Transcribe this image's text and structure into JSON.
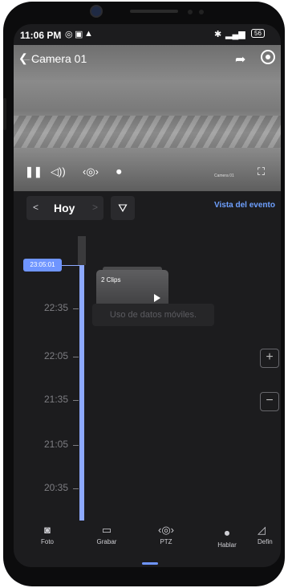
{
  "status": {
    "time": "11:06 PM",
    "battery": "56"
  },
  "camera": {
    "title": "Camera 01",
    "osd_timestamp": "—— —— —— ——",
    "osd_label": "Camera 01"
  },
  "controls": [
    "pause",
    "volume",
    "ptz",
    "mic",
    "fullscreen"
  ],
  "date_selector": {
    "label": "Hoy",
    "prev": "<",
    "next": ">"
  },
  "event_view_link": "Vista del evento",
  "timeline": {
    "current_time": "23:05:01",
    "labels": [
      "22:35",
      "22:05",
      "21:35",
      "21:05",
      "20:35"
    ]
  },
  "clip_card": {
    "title": "2 Clips"
  },
  "toast": "Uso de datos móviles.",
  "zoom": {
    "in": "+",
    "out": "−"
  },
  "bottom_nav": [
    {
      "label": "Foto",
      "icon": "camera-icon"
    },
    {
      "label": "Grabar",
      "icon": "record-icon"
    },
    {
      "label": "PTZ",
      "icon": "ptz-icon"
    },
    {
      "label": "Hablar",
      "icon": "mic-icon"
    },
    {
      "label": "Defin",
      "icon": "definition-icon"
    }
  ],
  "colors": {
    "accent": "#6f95ff",
    "background": "#1c1c1e",
    "link": "#6ea0ff"
  }
}
